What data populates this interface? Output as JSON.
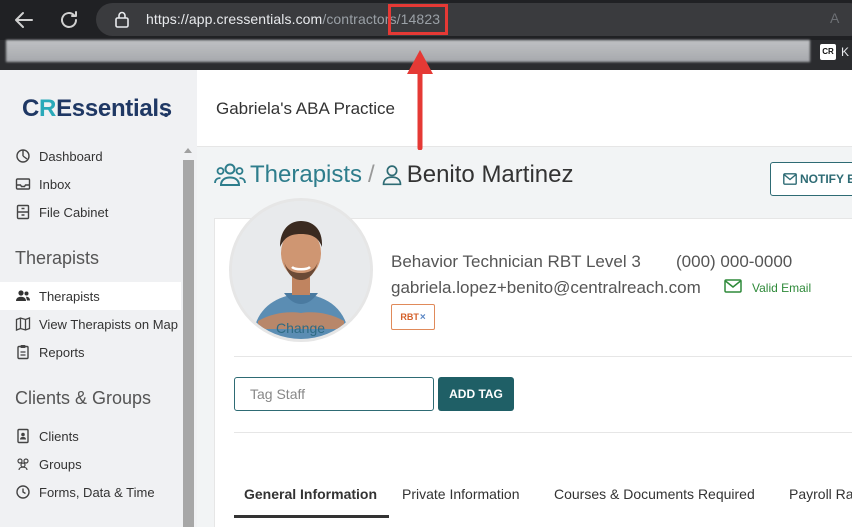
{
  "browser": {
    "url_host": "https://app.cressentials.com",
    "url_path": "/contractors/14823",
    "bookmark_label": "K",
    "bookmark_icon_text": "CR",
    "read_aloud_glyph": "A"
  },
  "sidebar": {
    "logo": {
      "cr": "C",
      "r": "R",
      "rest": "Essentials"
    },
    "items_top": [
      {
        "label": "Dashboard",
        "icon": "dashboard-icon"
      },
      {
        "label": "Inbox",
        "icon": "inbox-icon"
      },
      {
        "label": "File Cabinet",
        "icon": "file-cabinet-icon"
      }
    ],
    "section_therapists": "Therapists",
    "items_therapists": [
      {
        "label": "Therapists",
        "icon": "users-icon",
        "active": true
      },
      {
        "label": "View Therapists on Map",
        "icon": "map-icon"
      },
      {
        "label": "Reports",
        "icon": "clipboard-icon"
      }
    ],
    "section_clients": "Clients & Groups",
    "items_clients": [
      {
        "label": "Clients",
        "icon": "client-icon"
      },
      {
        "label": "Groups",
        "icon": "users-icon"
      },
      {
        "label": "Forms, Data & Time",
        "icon": "clock-icon"
      }
    ]
  },
  "header": {
    "practice_name": "Gabriela's ABA Practice"
  },
  "breadcrumb": {
    "parent": "Therapists",
    "separator": "/",
    "current": "Benito Martinez"
  },
  "notify_button": "NOTIFY E",
  "profile": {
    "change_photo": "Change",
    "job_title": "Behavior Technician RBT Level 3",
    "phone": "(000) 000-0000",
    "email": "gabriela.lopez+benito@centralreach.com",
    "email_status": "Valid Email",
    "tag": "RBT",
    "tag_remove": "×"
  },
  "tags": {
    "placeholder": "Tag Staff",
    "add_button": "ADD TAG"
  },
  "tabs": [
    {
      "label": "General Information",
      "active": true
    },
    {
      "label": "Private Information"
    },
    {
      "label": "Courses & Documents Required"
    },
    {
      "label": "Payroll Ra"
    }
  ],
  "colors": {
    "accent": "#2e6b74",
    "link": "#2e7d8c",
    "valid": "#2f8a3a",
    "highlight": "#e53935"
  }
}
